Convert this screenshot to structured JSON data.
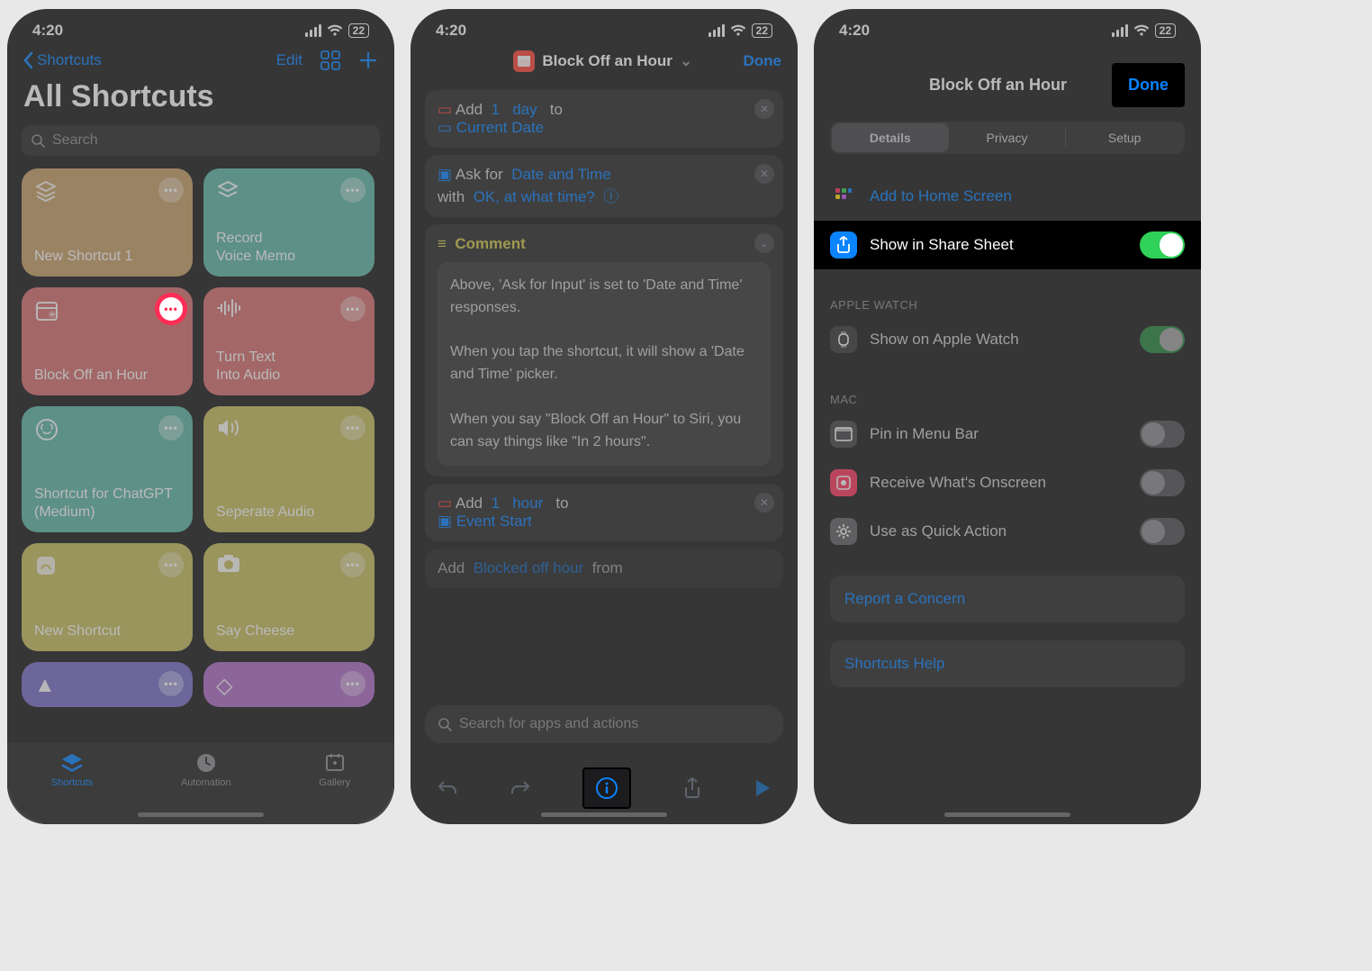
{
  "status": {
    "time": "4:20",
    "battery": "22"
  },
  "screen1": {
    "back_label": "Shortcuts",
    "edit_label": "Edit",
    "title": "All Shortcuts",
    "search_placeholder": "Search",
    "tiles": [
      {
        "label": "New Shortcut 1",
        "color": "#c9a16a"
      },
      {
        "label": "Record\nVoice Memo",
        "color": "#5fb7a6"
      },
      {
        "label": "Block Off an Hour",
        "color": "#d87070",
        "highlighted": true
      },
      {
        "label": "Turn Text\nInto Audio",
        "color": "#d87070"
      },
      {
        "label": "Shortcut for ChatGPT (Medium)",
        "color": "#5fb7a6"
      },
      {
        "label": "Seperate Audio",
        "color": "#c8bd5f"
      },
      {
        "label": "New Shortcut",
        "color": "#c8bd5f"
      },
      {
        "label": "Say Cheese",
        "color": "#c8bd5f"
      }
    ],
    "tabs": {
      "shortcuts": "Shortcuts",
      "automation": "Automation",
      "gallery": "Gallery"
    }
  },
  "screen2": {
    "title": "Block Off an Hour",
    "done": "Done",
    "action1": {
      "prefix": "Add",
      "num": "1",
      "unit": "day",
      "to": "to",
      "target": "Current Date"
    },
    "action2": {
      "prefix": "Ask for",
      "type": "Date and Time",
      "with": "with",
      "prompt": "OK, at what time?"
    },
    "comment_label": "Comment",
    "comment_body": "Above, 'Ask for Input' is set to 'Date and Time' responses.\n\nWhen you tap the shortcut, it will show a 'Date and Time' picker.\n\nWhen you say \"Block Off an Hour\" to Siri, you can say things like \"In 2 hours\".",
    "action3": {
      "prefix": "Add",
      "num": "1",
      "unit": "hour",
      "to": "to",
      "target": "Event Start"
    },
    "action4": {
      "prefix": "Add",
      "name": "Blocked off hour",
      "from": "from"
    },
    "search_placeholder": "Search for apps and actions"
  },
  "screen3": {
    "title": "Block Off an Hour",
    "done": "Done",
    "tabs": {
      "details": "Details",
      "privacy": "Privacy",
      "setup": "Setup"
    },
    "rows": {
      "addhome": "Add to Home Screen",
      "sharesheet": "Show in Share Sheet",
      "applewatch_head": "APPLE WATCH",
      "applewatch": "Show on Apple Watch",
      "mac_head": "MAC",
      "menubar": "Pin in Menu Bar",
      "onscreen": "Receive What's Onscreen",
      "quickaction": "Use as Quick Action",
      "report": "Report a Concern",
      "help": "Shortcuts Help"
    }
  }
}
